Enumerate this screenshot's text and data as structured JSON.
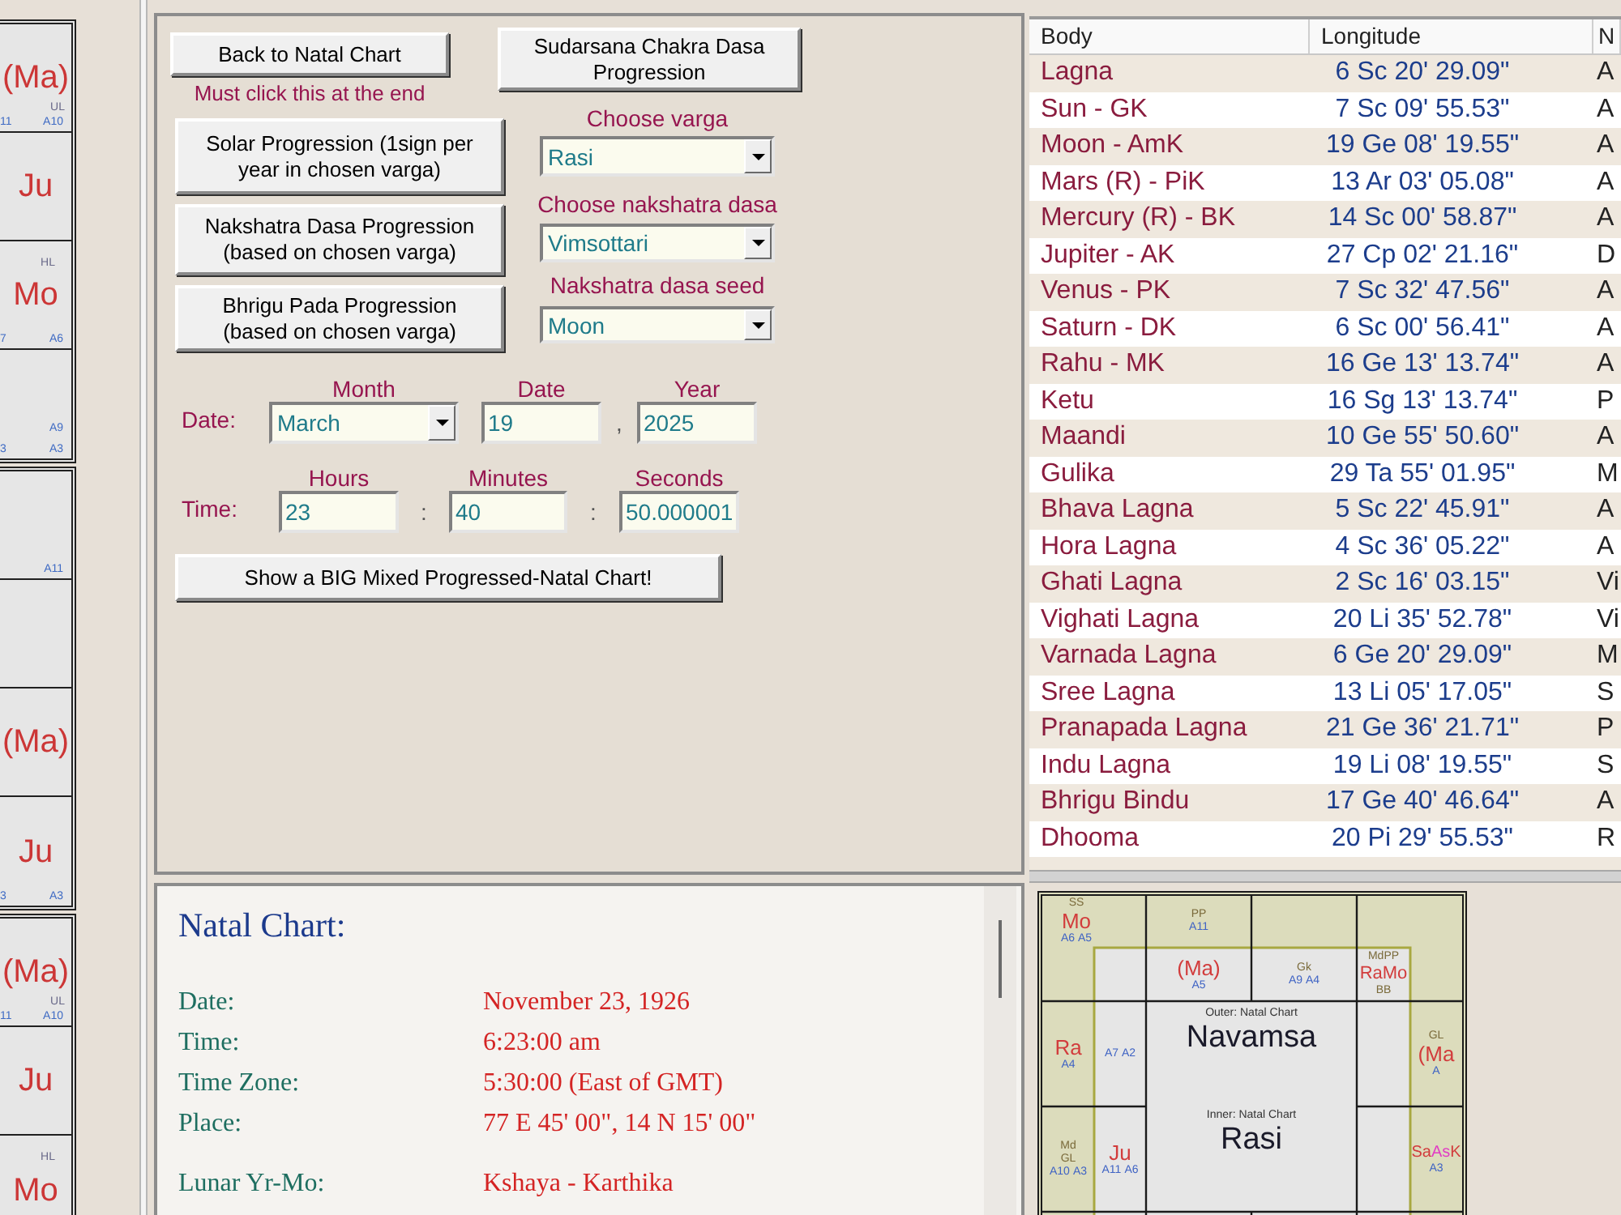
{
  "side_charts": [
    {
      "cells": [
        {
          "lines": [
            {
              "kind": "planet",
              "texts": [
                "(Ma)"
              ]
            },
            {
              "kind": "tag",
              "texts": [
                "UL"
              ]
            },
            {
              "kind": "arudha",
              "texts": [
                "11",
                "A10"
              ]
            }
          ]
        },
        {
          "lines": [
            {
              "kind": "planet",
              "texts": [
                "Ju"
              ]
            }
          ]
        },
        {
          "lines": [
            {
              "kind": "tag",
              "texts": [
                "HL"
              ]
            },
            {
              "kind": "planet",
              "texts": [
                "Mo"
              ]
            },
            {
              "kind": "arudha",
              "texts": [
                "7",
                "A6"
              ]
            }
          ]
        },
        {
          "lines": [
            {
              "kind": "arudha",
              "texts": [
                "A9"
              ]
            },
            {
              "kind": "arudha",
              "texts": [
                "3",
                "A3"
              ]
            }
          ]
        }
      ]
    },
    {
      "cells": [
        {
          "lines": [
            {
              "kind": "arudha",
              "texts": [
                "A11"
              ]
            }
          ]
        },
        {},
        {
          "lines": [
            {
              "kind": "planet",
              "texts": [
                "(Ma)"
              ]
            }
          ]
        },
        {
          "lines": [
            {
              "kind": "planet",
              "texts": [
                "Ju"
              ]
            },
            {
              "kind": "arudha",
              "texts": [
                "3",
                "A3"
              ]
            }
          ]
        }
      ]
    },
    {
      "cells": [
        {
          "lines": [
            {
              "kind": "planet",
              "texts": [
                "(Ma)"
              ]
            },
            {
              "kind": "tag",
              "texts": [
                "UL"
              ]
            },
            {
              "kind": "arudha",
              "texts": [
                "11",
                "A10"
              ]
            }
          ]
        },
        {
          "lines": [
            {
              "kind": "planet",
              "texts": [
                "Ju"
              ]
            }
          ]
        },
        {
          "lines": [
            {
              "kind": "tag",
              "texts": [
                "HL"
              ]
            },
            {
              "kind": "planet",
              "texts": [
                "Mo"
              ]
            }
          ]
        }
      ]
    }
  ],
  "progression_panel": {
    "back_button": "Back to Natal Chart",
    "back_note": "Must click this at the end",
    "sudarsana_button": {
      "lines": [
        "Sudarsana Chakra Dasa",
        "Progression"
      ]
    },
    "progression_buttons": [
      {
        "lines": [
          "Solar Progression (1sign per",
          "year in chosen varga)"
        ]
      },
      {
        "lines": [
          "Nakshatra Dasa Progression",
          "(based on chosen varga)"
        ]
      },
      {
        "lines": [
          "Bhrigu Pada Progression",
          "(based on chosen varga)"
        ]
      }
    ],
    "dropdowns": [
      {
        "label": "Choose varga",
        "value": "Rasi"
      },
      {
        "label": "Choose nakshatra dasa",
        "value": "Vimsottari"
      },
      {
        "label": "Nakshatra dasa seed",
        "value": "Moon"
      }
    ],
    "datetime_rows": [
      {
        "label": "Date:",
        "fields": [
          {
            "kind": "dropdown",
            "label": "Month",
            "value": "March"
          },
          {
            "kind": "text",
            "label": "Date",
            "value": "19"
          },
          {
            "kind": "text",
            "label": "Year",
            "value": "2025",
            "separator": ","
          }
        ]
      },
      {
        "label": "Time:",
        "fields": [
          {
            "kind": "text",
            "label": "Hours",
            "value": "23"
          },
          {
            "kind": "text",
            "label": "Minutes",
            "value": "40",
            "separator": ":"
          },
          {
            "kind": "text",
            "label": "Seconds",
            "value": "50.000001",
            "separator": ":"
          }
        ]
      }
    ],
    "chart_button": "Show a BIG Mixed Progressed-Natal Chart!"
  },
  "planet_table": {
    "columns": [
      "Body",
      "Longitude",
      "N"
    ],
    "rows": [
      {
        "cells": [
          "Lagna",
          "6 Sc 20' 29.09\"",
          "A"
        ]
      },
      {
        "cells": [
          "Sun - GK",
          "7 Sc 09' 55.53\"",
          "A"
        ]
      },
      {
        "cells": [
          "Moon - AmK",
          "19 Ge 08' 19.55\"",
          "A"
        ]
      },
      {
        "cells": [
          "Mars (R) - PiK",
          "13 Ar 03' 05.08\"",
          "A"
        ]
      },
      {
        "cells": [
          "Mercury (R) - BK",
          "14 Sc 00' 58.87\"",
          "A"
        ]
      },
      {
        "cells": [
          "Jupiter - AK",
          "27 Cp 02' 21.16\"",
          "D"
        ]
      },
      {
        "cells": [
          "Venus - PK",
          "7 Sc 32' 47.56\"",
          "A"
        ]
      },
      {
        "cells": [
          "Saturn - DK",
          "6 Sc 00' 56.41\"",
          "A"
        ]
      },
      {
        "cells": [
          "Rahu - MK",
          "16 Ge 13' 13.74\"",
          "A"
        ]
      },
      {
        "cells": [
          "Ketu",
          "16 Sg 13' 13.74\"",
          "P"
        ]
      },
      {
        "cells": [
          "Maandi",
          "10 Ge 55' 50.60\"",
          "A"
        ]
      },
      {
        "cells": [
          "Gulika",
          "29 Ta 55' 01.95\"",
          "M"
        ]
      },
      {
        "cells": [
          "Bhava Lagna",
          "5 Sc 22' 45.91\"",
          "A"
        ]
      },
      {
        "cells": [
          "Hora Lagna",
          "4 Sc 36' 05.22\"",
          "A"
        ]
      },
      {
        "cells": [
          "Ghati Lagna",
          "2 Sc 16' 03.15\"",
          "Vi"
        ]
      },
      {
        "cells": [
          "Vighati Lagna",
          "20 Li 35' 52.78\"",
          "Vi"
        ]
      },
      {
        "cells": [
          "Varnada Lagna",
          "6 Ge 20' 29.09\"",
          "M"
        ]
      },
      {
        "cells": [
          "Sree Lagna",
          "13 Li 05' 17.05\"",
          "S"
        ]
      },
      {
        "cells": [
          "Pranapada Lagna",
          "21 Ge 36' 21.71\"",
          "P"
        ]
      },
      {
        "cells": [
          "Indu Lagna",
          "19 Li 08' 19.55\"",
          "S"
        ]
      },
      {
        "cells": [
          "Bhrigu Bindu",
          "17 Ge 40' 46.64\"",
          "A"
        ]
      },
      {
        "cells": [
          "Dhooma",
          "20 Pi 29' 55.53\"",
          "R"
        ]
      }
    ]
  },
  "natal_details": {
    "title": "Natal Chart:",
    "groups": [
      [
        {
          "label": "Date:",
          "value": "November 23, 1926"
        },
        {
          "label": "Time:",
          "value": "6:23:00 am"
        },
        {
          "label": "Time Zone:",
          "value": "5:30:00 (East of GMT)"
        },
        {
          "label": "Place:",
          "value": "77 E 45' 00\", 14 N 15' 00\""
        }
      ],
      [
        {
          "label": "Lunar Yr-Mo:",
          "value": "Kshaya - Karthika"
        }
      ]
    ]
  },
  "overlay_chart": {
    "outer_caption": "Outer: Natal Chart",
    "outer_varga": "Navamsa",
    "inner_caption": "Inner: Natal Chart",
    "inner_varga": "Rasi",
    "outer_cells": [
      {
        "lines": [
          {
            "kind": "tag",
            "texts": [
              "SS"
            ]
          },
          {
            "kind": "planet",
            "texts": [
              "Mo"
            ]
          },
          {
            "kind": "arudha",
            "texts": [
              "A6",
              "A5"
            ]
          }
        ]
      },
      {
        "lines": [
          {
            "kind": "tag",
            "texts": [
              "PP"
            ]
          },
          {
            "kind": "arudha",
            "texts": [
              "A11"
            ]
          }
        ]
      },
      {},
      {},
      {
        "lines": [
          {
            "kind": "planet",
            "texts": [
              "Ra"
            ]
          },
          {
            "kind": "arudha",
            "texts": [
              "A4"
            ]
          }
        ]
      },
      {
        "lines": [
          {
            "kind": "tag",
            "texts": [
              "GL"
            ]
          },
          {
            "kind": "planet",
            "texts": [
              "(Ma"
            ]
          },
          {
            "kind": "arudha",
            "texts": [
              "A"
            ]
          }
        ]
      },
      {
        "lines": [
          {
            "kind": "tag",
            "texts": [
              "Md"
            ]
          },
          {
            "kind": "tag",
            "texts": [
              "GL"
            ]
          },
          {
            "kind": "arudha",
            "texts": [
              "A10",
              "A3"
            ]
          }
        ]
      },
      {
        "lines": [
          {
            "kind": "planet",
            "texts": [
              {
                "text": "Sa",
                "color": "#d23c3c"
              },
              {
                "text": "As",
                "color": "#e23cc4"
              },
              {
                "text": "K",
                "color": "#d23c3c"
              }
            ]
          },
          {
            "kind": "arudha",
            "texts": [
              "A3"
            ]
          }
        ]
      }
    ],
    "inner_cells": [
      {},
      {
        "lines": [
          {
            "kind": "planet",
            "texts": [
              "(Ma)"
            ]
          },
          {
            "kind": "arudha",
            "texts": [
              "A5"
            ]
          }
        ]
      },
      {
        "lines": [
          {
            "kind": "tag",
            "texts": [
              "Gk"
            ]
          },
          {
            "kind": "arudha",
            "texts": [
              "A9",
              "A4"
            ]
          }
        ]
      },
      {
        "lines": [
          {
            "kind": "tag",
            "texts": [
              "MdPP"
            ]
          },
          {
            "kind": "planet",
            "texts": [
              "Ra",
              "Mo"
            ]
          },
          {
            "kind": "tag",
            "texts": [
              "BB"
            ]
          }
        ]
      },
      {
        "lines": [
          {
            "kind": "arudha",
            "texts": [
              "A7",
              "A2"
            ]
          }
        ]
      },
      {},
      {
        "lines": [
          {
            "kind": "planet",
            "texts": [
              "Ju"
            ]
          },
          {
            "kind": "arudha",
            "texts": [
              "A11",
              "A6"
            ]
          }
        ]
      },
      {}
    ]
  }
}
